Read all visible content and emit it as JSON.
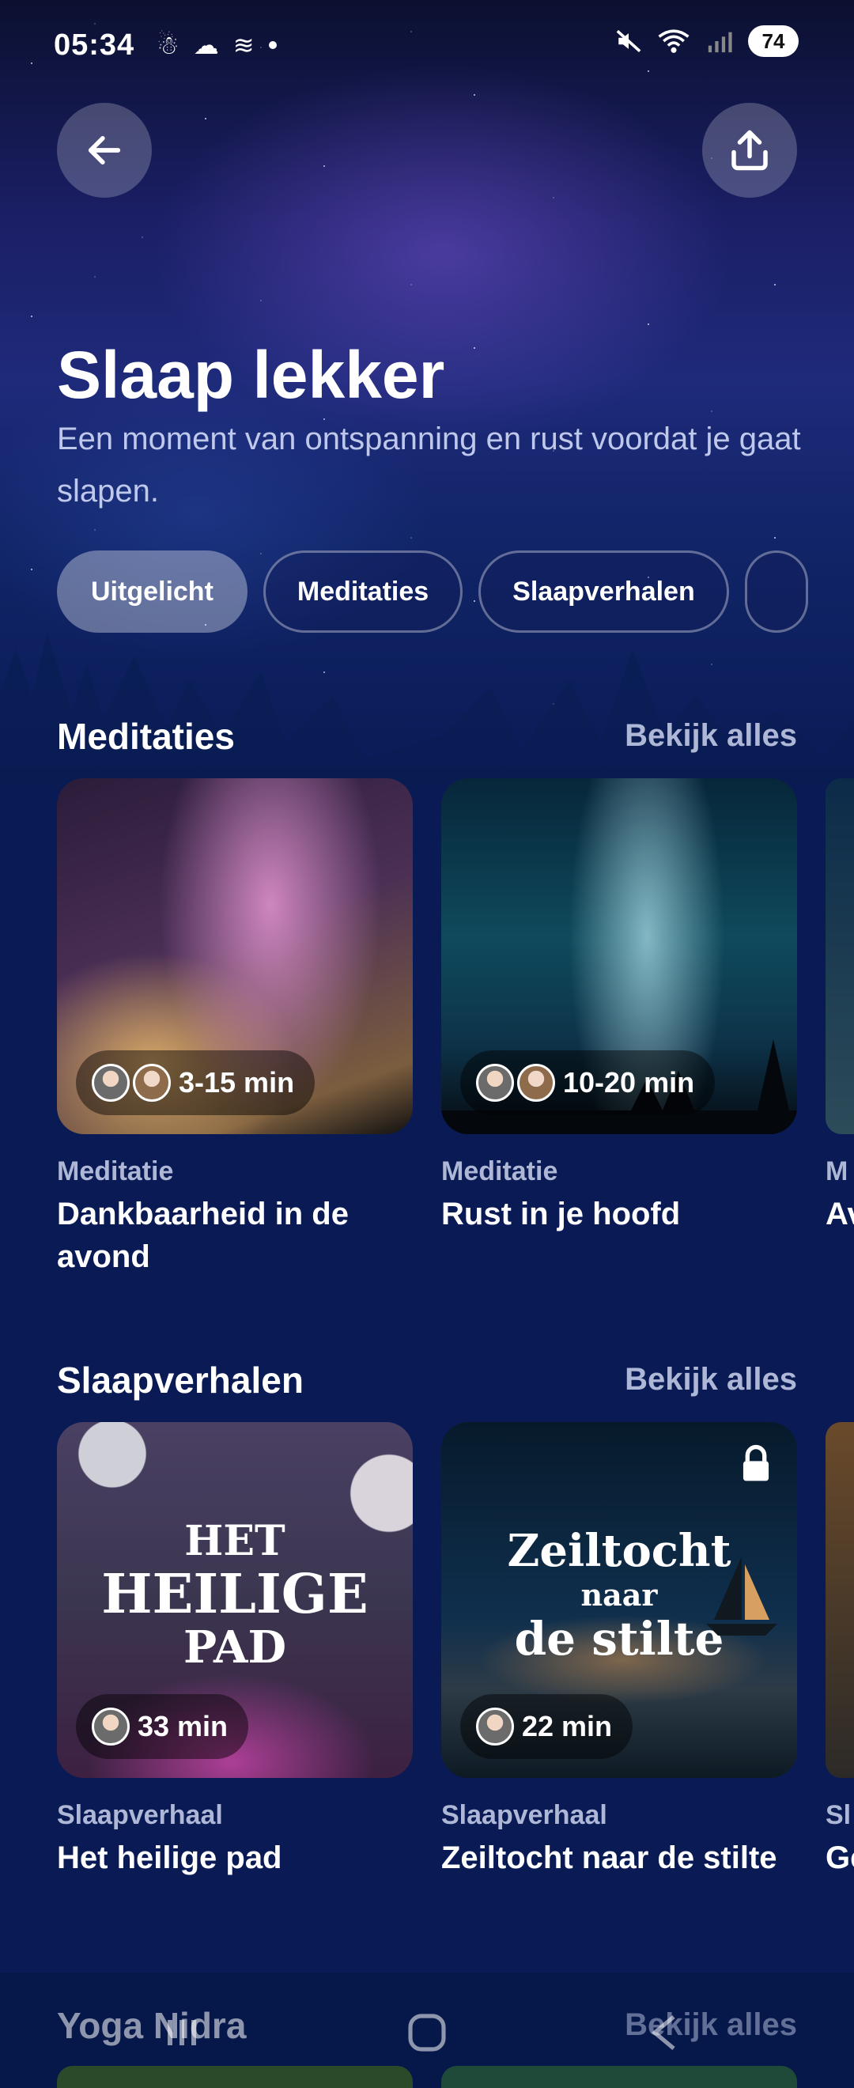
{
  "status_bar": {
    "time": "05:34",
    "battery": "74"
  },
  "header": {
    "title": "Slaap lekker",
    "subtitle": "Een moment van ontspanning en rust voordat je gaat slapen."
  },
  "chips": [
    {
      "label": "Uitgelicht",
      "active": true
    },
    {
      "label": "Meditaties",
      "active": false
    },
    {
      "label": "Slaapverhalen",
      "active": false
    }
  ],
  "sections": {
    "meditaties": {
      "title": "Meditaties",
      "see_all": "Bekijk alles",
      "cards": [
        {
          "duration": "3-15 min",
          "type": "Meditatie",
          "title": "Dankbaarheid in de avond"
        },
        {
          "duration": "10-20 min",
          "type": "Meditatie",
          "title": "Rust in je hoofd"
        },
        {
          "type": "M",
          "title": "Av"
        }
      ]
    },
    "slaapverhalen": {
      "title": "Slaapverhalen",
      "see_all": "Bekijk alles",
      "cards": [
        {
          "duration": "33 min",
          "type": "Slaapverhaal",
          "title": "Het heilige pad",
          "art_lines": [
            "HET",
            "HEILIGE",
            "PAD"
          ]
        },
        {
          "duration": "22 min",
          "type": "Slaapverhaal",
          "title": "Zeiltocht naar de stilte",
          "art_lines": [
            "Zeiltocht",
            "naar",
            "de stilte"
          ],
          "locked": true
        },
        {
          "type": "Sl",
          "title": "Ge"
        }
      ]
    },
    "yoga_nidra": {
      "title": "Yoga Nidra",
      "see_all": "Bekijk alles"
    }
  },
  "icons": {
    "back": "arrow-left-icon",
    "share": "share-icon",
    "lock": "lock-icon"
  }
}
